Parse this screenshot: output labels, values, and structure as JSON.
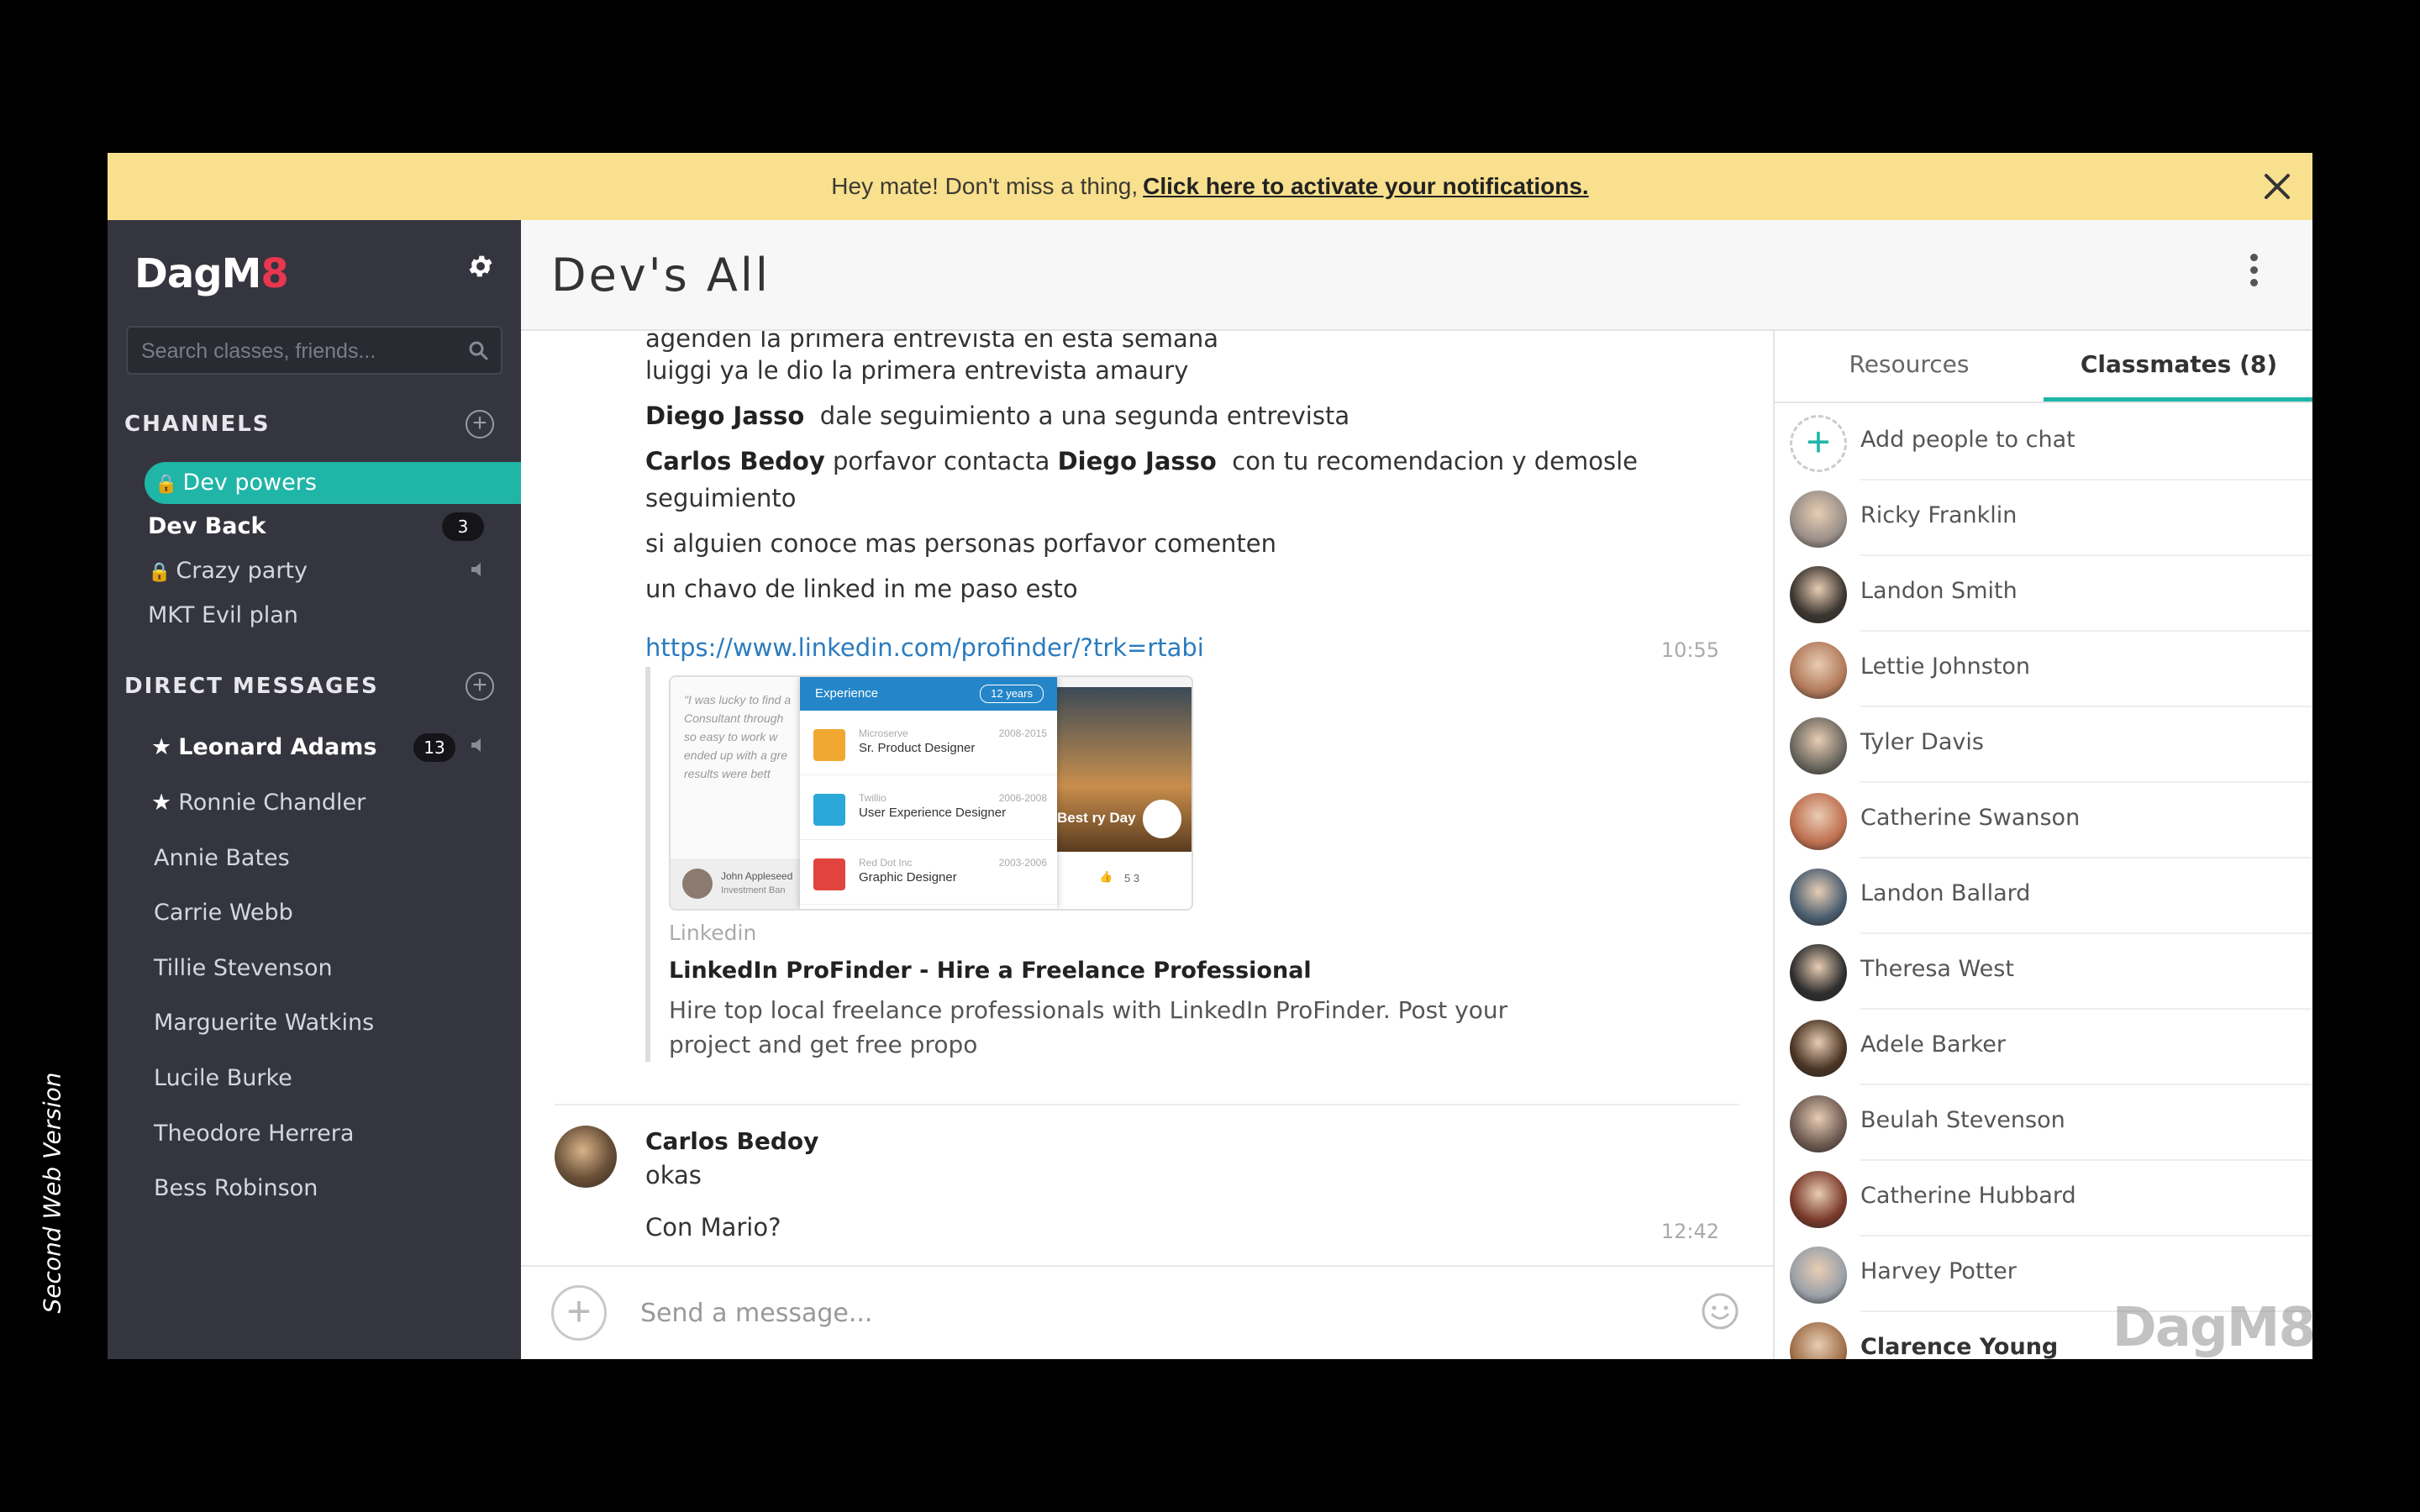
{
  "caption": "Second Web Version",
  "banner": {
    "text": "Hey mate! Don't miss a thing,",
    "link": "Click here to activate your notifications."
  },
  "sidebar": {
    "logo_main": "DagM",
    "logo_accent": "8",
    "search_placeholder": "Search classes, friends...",
    "channels_heading": "CHANNELS",
    "channels": [
      {
        "label": "Dev powers",
        "locked": true,
        "active": true
      },
      {
        "label": "Dev Back",
        "badge": "3",
        "bold": true
      },
      {
        "label": "Crazy party",
        "locked": true,
        "muted": true
      },
      {
        "label": "MKT Evil plan"
      }
    ],
    "dm_heading": "DIRECT MESSAGES",
    "direct_messages": [
      {
        "label": "Leonard Adams",
        "starred": true,
        "badge": "13",
        "bold": true,
        "muted": true
      },
      {
        "label": "Ronnie Chandler",
        "starred": true
      },
      {
        "label": "Annie Bates"
      },
      {
        "label": "Carrie Webb"
      },
      {
        "label": "Tillie Stevenson"
      },
      {
        "label": "Marguerite Watkins"
      },
      {
        "label": "Lucile Burke"
      },
      {
        "label": "Theodore Herrera"
      },
      {
        "label": "Bess Robinson"
      }
    ]
  },
  "header": {
    "title": "Dev's All"
  },
  "chat": {
    "partial_line": "agenden la primera entrevista en esta semana",
    "lines": {
      "l1": "luiggi ya le dio la primera entrevista amaury",
      "l2_name": "Diego Jasso",
      "l2_text": "dale seguimiento a una segunda entrevista",
      "l3_name1": "Carlos Bedoy",
      "l3_text1": "porfavor contacta",
      "l3_name2": "Diego Jasso",
      "l3_text2": "con tu recomendacion y demosle",
      "l3_cont": "seguimiento",
      "l4": "si alguien conoce mas personas porfavor comenten",
      "l5": "un chavo de linked in me paso esto"
    },
    "link_url": "https://www.linkedin.com/profinder/?trk=rtabi",
    "link_time": "10:55",
    "preview": {
      "source": "Linkedin",
      "title": "LinkedIn ProFinder - Hire a Freelance Professional",
      "desc": "Hire top local freelance professionals with LinkedIn ProFinder. Post your project and get free propo",
      "img_quote": "\"I was lucky to find a Consultant through so easy to work w ended up with a gre results were bett",
      "img_name": "John Appleseed",
      "img_role": "Investment Ban",
      "card_header": "Experience",
      "card_years": "12 years",
      "rows": [
        {
          "company": "Microserve",
          "role": "Sr. Product Designer",
          "dates": "2008-2015",
          "color": "#f0a830"
        },
        {
          "company": "Twillio",
          "role": "User Experience Designer",
          "dates": "2006-2008",
          "color": "#2ba8d8"
        },
        {
          "company": "Red Dot Inc",
          "role": "Graphic Designer",
          "dates": "2003-2006",
          "color": "#e0443c"
        }
      ],
      "photo_text": "Best ry Day",
      "photo_stats": "5   3"
    },
    "msg2": {
      "sender": "Carlos Bedoy",
      "text1": "okas",
      "text2": "Con Mario?",
      "time": "12:42"
    }
  },
  "composer": {
    "placeholder": "Send a message..."
  },
  "right_panel": {
    "tabs": [
      "Resources",
      "Classmates (8)"
    ],
    "add_people": "Add people to chat",
    "people": [
      {
        "name": "Ricky Franklin",
        "color": "#9a8f88"
      },
      {
        "name": "Landon Smith",
        "color": "#3c3630"
      },
      {
        "name": "Lettie Johnston",
        "color": "#b27a5a"
      },
      {
        "name": "Tyler Davis",
        "color": "#6c6860"
      },
      {
        "name": "Catherine Swanson",
        "color": "#c07050"
      },
      {
        "name": "Landon Ballard",
        "color": "#4a5e70"
      },
      {
        "name": "Theresa West",
        "color": "#2e2e2e"
      },
      {
        "name": "Adele Barker",
        "color": "#4a3424"
      },
      {
        "name": "Beulah Stevenson",
        "color": "#6e5a52"
      },
      {
        "name": "Catherine Hubbard",
        "color": "#7a3a2a"
      },
      {
        "name": "Harvey Potter",
        "color": "#9aa0a8"
      },
      {
        "name": "Clarence Young",
        "color": "#a0704a"
      }
    ]
  },
  "watermark": "DagM8",
  "colors": {
    "accent": "#1fb5a7",
    "banner": "#f8e08e",
    "sidebar": "#35353f",
    "link": "#2a7bbf"
  }
}
